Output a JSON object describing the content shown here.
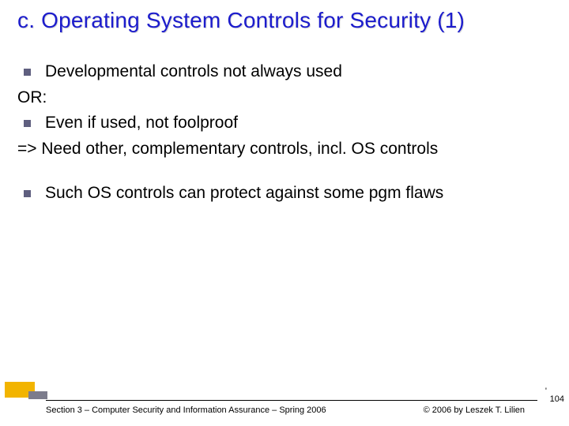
{
  "title": "c. Operating System Controls for Security (1)",
  "lines": {
    "l1": "Developmental controls not always used",
    "l2": "OR:",
    "l3": "Even if used, not foolproof",
    "l4": "=> Need other, complementary controls, incl. OS controls",
    "l5": "Such OS controls can protect against some pgm flaws"
  },
  "footer": {
    "left": "Section 3 – Computer Security and Information Assurance – Spring 2006",
    "right": "© 2006 by Leszek T. Lilien"
  },
  "page_apostrophe": "'",
  "page_number": "104"
}
